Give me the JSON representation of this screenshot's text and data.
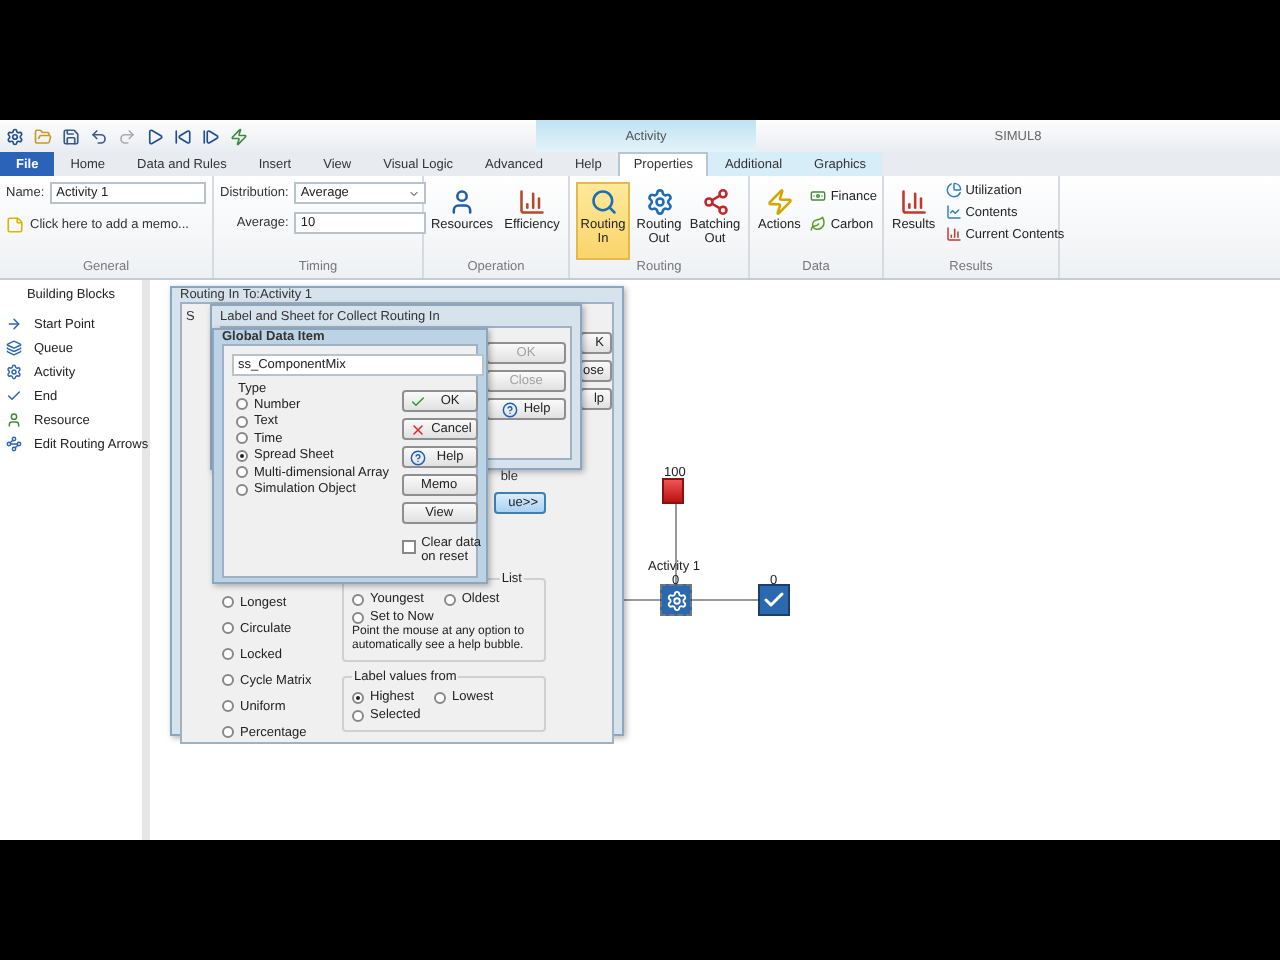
{
  "title_bar": {
    "context_tab": "Activity",
    "title": "SIMUL8"
  },
  "ribbon_tabs": [
    {
      "label": "File",
      "kind": "file",
      "selected": false
    },
    {
      "label": "Home",
      "kind": "tab",
      "selected": false
    },
    {
      "label": "Data and Rules",
      "kind": "tab",
      "selected": false
    },
    {
      "label": "Insert",
      "kind": "tab",
      "selected": false
    },
    {
      "label": "View",
      "kind": "tab",
      "selected": false
    },
    {
      "label": "Visual Logic",
      "kind": "tab",
      "selected": false
    },
    {
      "label": "Advanced",
      "kind": "tab",
      "selected": false
    },
    {
      "label": "Help",
      "kind": "tab",
      "selected": false
    },
    {
      "label": "Properties",
      "kind": "context",
      "selected": true
    },
    {
      "label": "Additional",
      "kind": "context",
      "selected": false
    },
    {
      "label": "Graphics",
      "kind": "context",
      "selected": false
    }
  ],
  "ribbon": {
    "general": {
      "label": "General",
      "name_label": "Name:",
      "name_value": "Activity 1",
      "memo": "Click here to add a memo..."
    },
    "timing": {
      "label": "Timing",
      "distribution_label": "Distribution:",
      "distribution_value": "Average",
      "average_label": "Average:",
      "average_value": "10"
    },
    "operation": {
      "label": "Operation",
      "buttons": [
        "Resources",
        "Efficiency"
      ]
    },
    "routing": {
      "label": "Routing",
      "buttons": [
        {
          "label": "Routing In",
          "selected": true
        },
        {
          "label": "Routing Out",
          "selected": false
        },
        {
          "label": "Batching Out",
          "selected": false
        }
      ]
    },
    "data": {
      "label": "Data",
      "big": "Actions",
      "small": [
        "Finance",
        "Carbon"
      ]
    },
    "results": {
      "label": "Results",
      "big": "Results",
      "small": [
        "Utilization",
        "Contents",
        "Current Contents"
      ]
    }
  },
  "sidebar": {
    "title": "Building Blocks",
    "items": [
      {
        "label": "Start Point",
        "kind": "start"
      },
      {
        "label": "Queue",
        "kind": "queue"
      },
      {
        "label": "Activity",
        "kind": "activity"
      },
      {
        "label": "End",
        "kind": "end"
      },
      {
        "label": "Resource",
        "kind": "resource"
      },
      {
        "label": "Edit Routing Arrows",
        "kind": "arrows"
      }
    ]
  },
  "canvas": {
    "source_count": "100",
    "activity_label": "Activity 1",
    "activity_count": "0",
    "end_count": "0"
  },
  "routing_dialog": {
    "title": "Routing In To:Activity 1",
    "fragment": "S",
    "buttons": [
      "K",
      "ose",
      "lp"
    ],
    "table_fragment": "ble",
    "values_button": "ue>>",
    "list_legend": "List",
    "rules": [
      {
        "label": "Longest",
        "checked": false
      },
      {
        "label": "Circulate",
        "checked": false
      },
      {
        "label": "Locked",
        "checked": false
      },
      {
        "label": "Cycle Matrix",
        "checked": false
      },
      {
        "label": "Uniform",
        "checked": false
      },
      {
        "label": "Percentage",
        "checked": false
      }
    ],
    "age": [
      {
        "label": "Youngest",
        "checked": false
      },
      {
        "label": "Oldest",
        "checked": false
      },
      {
        "label": "Set to Now",
        "checked": false
      }
    ],
    "hint": "Point the mouse at any option to automatically see a help bubble.",
    "label_values": {
      "legend": "Label values from",
      "options": [
        {
          "label": "Highest",
          "checked": true
        },
        {
          "label": "Lowest",
          "checked": false
        },
        {
          "label": "Selected",
          "checked": false
        }
      ]
    }
  },
  "label_dialog": {
    "title": "Label and Sheet for Collect Routing In",
    "buttons": [
      {
        "label": "OK",
        "disabled": true
      },
      {
        "label": "Close",
        "disabled": true
      },
      {
        "label": "Help",
        "disabled": false,
        "kind": "help"
      }
    ]
  },
  "global_dialog": {
    "title": "Global Data Item",
    "value": "ss_ComponentMix",
    "type_legend": "Type",
    "types": [
      {
        "label": "Number",
        "selected": false
      },
      {
        "label": "Text",
        "selected": false
      },
      {
        "label": "Time",
        "selected": false
      },
      {
        "label": "Spread Sheet",
        "selected": true
      },
      {
        "label": "Multi-dimensional Array",
        "selected": false
      },
      {
        "label": "Simulation Object",
        "selected": false
      }
    ],
    "buttons": [
      {
        "label": "OK",
        "kind": "ok"
      },
      {
        "label": "Cancel",
        "kind": "cancel"
      },
      {
        "label": "Help",
        "kind": "help"
      },
      {
        "label": "Memo",
        "kind": "plain"
      },
      {
        "label": "View",
        "kind": "plain"
      }
    ],
    "clear_on_reset": {
      "label": "Clear data on reset",
      "checked": false
    }
  }
}
